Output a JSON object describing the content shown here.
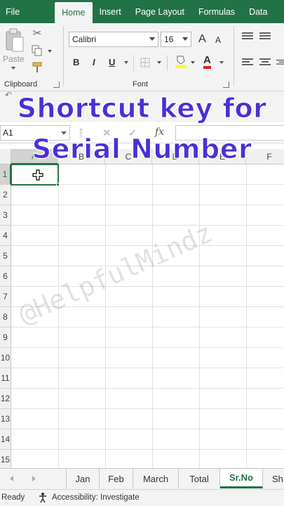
{
  "ribbon_tabs": [
    "File",
    "Home",
    "Insert",
    "Page Layout",
    "Formulas",
    "Data"
  ],
  "active_tab": "Home",
  "clipboard": {
    "paste_label": "Paste",
    "group_label": "Clipboard"
  },
  "font": {
    "name": "Calibri",
    "size": "16",
    "group_label": "Font",
    "bold": "B",
    "italic": "I",
    "underline": "U",
    "grow": "A",
    "shrink": "A",
    "font_color": "A",
    "highlight_color": "#ffff00",
    "text_color": "#e31b1b"
  },
  "formula_bar": {
    "name_box": "A1",
    "cancel": "✕",
    "enter": "✓",
    "fx": "fx",
    "value": ""
  },
  "columns": [
    "A",
    "B",
    "C",
    "D",
    "E",
    "F"
  ],
  "rows": [
    "1",
    "2",
    "3",
    "4",
    "5",
    "6",
    "7",
    "8",
    "9",
    "10",
    "11",
    "12",
    "13",
    "14",
    "15"
  ],
  "overlay": {
    "line1": "Shortcut key for",
    "line2": "Serial Number"
  },
  "watermark": "@HelpfulMindz",
  "sheets": [
    "Jan",
    "Feb",
    "March",
    "Total",
    "Sr.No",
    "Sh"
  ],
  "active_sheet": "Sr.No",
  "status": {
    "ready": "Ready",
    "accessibility": "Accessibility: Investigate"
  },
  "colors": {
    "excel_green": "#217346",
    "overlay_text": "#4b2fd6"
  }
}
